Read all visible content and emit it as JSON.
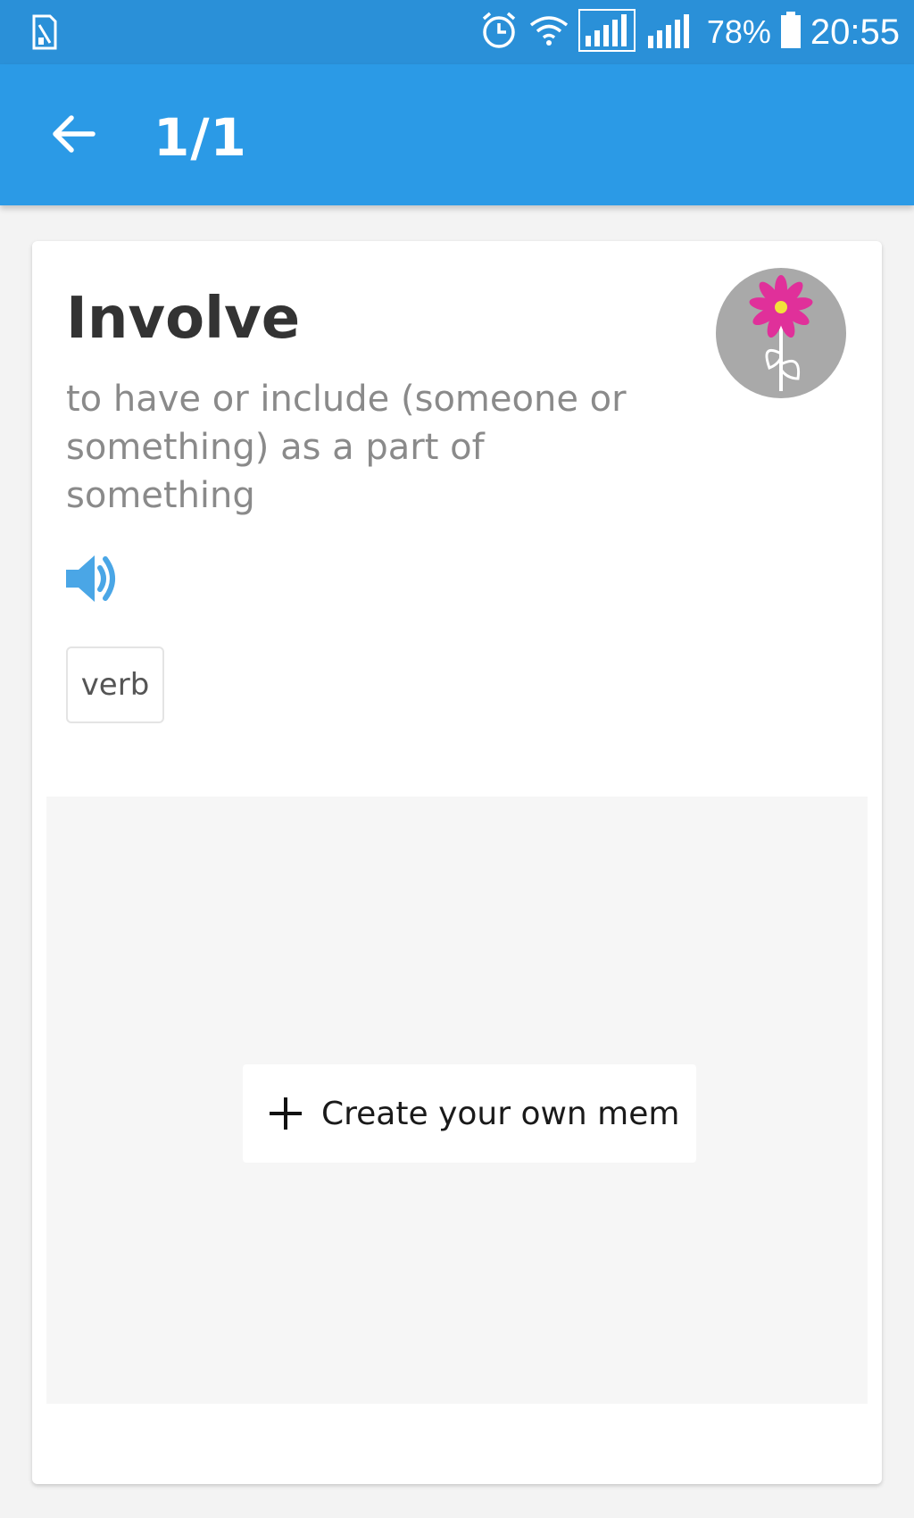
{
  "status_bar": {
    "battery_percent": "78%",
    "time": "20:55",
    "icons": [
      "sim-card-icon",
      "alarm-icon",
      "wifi-icon",
      "signal-icon",
      "signal-icon",
      "battery-icon"
    ]
  },
  "app_bar": {
    "back_icon": "arrow-left-icon",
    "counter": "1/1"
  },
  "card": {
    "word": "Involve",
    "definition": "to have or include (someone or something) as a part of something",
    "audio_icon": "speaker-icon",
    "part_of_speech": "verb",
    "avatar_icon": "flower-icon",
    "create_mem_label": "Create your own mem",
    "create_mem_icon": "plus-icon"
  },
  "colors": {
    "status_bar": "#2a90d8",
    "app_bar": "#2b9ae6",
    "accent_speaker": "#4aa6e6",
    "flower_petal": "#e0309a"
  }
}
